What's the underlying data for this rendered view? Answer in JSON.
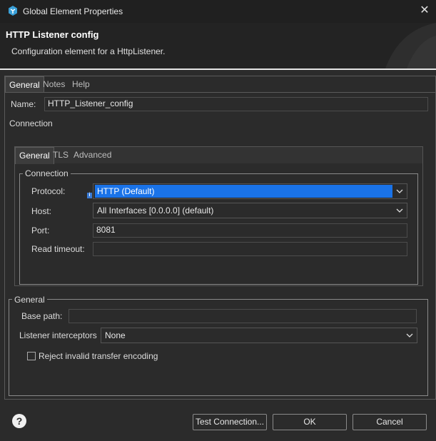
{
  "window": {
    "title": "Global Element Properties",
    "close_glyph": "✕"
  },
  "header": {
    "title": "HTTP Listener config",
    "description": "Configuration element for a HttpListener."
  },
  "outer_tabs": [
    "General",
    "Notes",
    "Help"
  ],
  "name_field": {
    "label": "Name:",
    "value": "HTTP_Listener_config"
  },
  "connection_label": "Connection",
  "inner_tabs": [
    "General",
    "TLS",
    "Advanced"
  ],
  "connection_group": {
    "title": "Connection",
    "protocol": {
      "label": "Protocol:",
      "value": "HTTP (Default)"
    },
    "host": {
      "label": "Host:",
      "value": "All Interfaces [0.0.0.0] (default)"
    },
    "port": {
      "label": "Port:",
      "value": "8081"
    },
    "read_timeout": {
      "label": "Read timeout:",
      "value": ""
    }
  },
  "general_group": {
    "title": "General",
    "base_path": {
      "label": "Base path:",
      "value": ""
    },
    "listener_interceptors": {
      "label": "Listener interceptors",
      "value": "None"
    },
    "reject_checkbox": {
      "label": "Reject invalid transfer encoding",
      "checked": false
    }
  },
  "footer": {
    "help_glyph": "?",
    "test_connection": "Test Connection...",
    "ok": "OK",
    "cancel": "Cancel"
  },
  "icons": {
    "app": "mule-app-icon",
    "help": "help-icon",
    "chevron": "chevron-down-icon",
    "info": "info-icon"
  },
  "colors": {
    "selection": "#1a73e8",
    "background": "#2b2b2b"
  }
}
